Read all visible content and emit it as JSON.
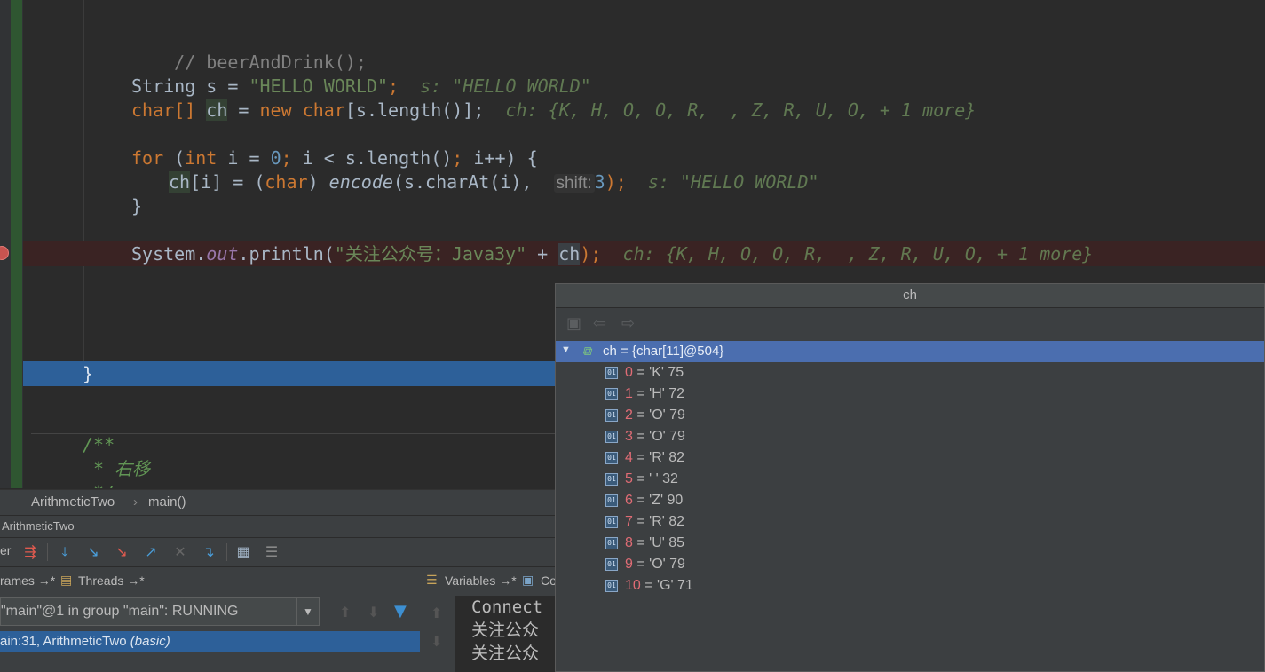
{
  "editor": {
    "comment_line": "// beerAndDrink();",
    "line_s": {
      "type": "String",
      "var": "s",
      "op": " = ",
      "value": "\"HELLO WORLD\"",
      "semi": ";",
      "inline": "s: \"HELLO WORLD\""
    },
    "line_ch": {
      "type": "char[]",
      "var": "ch",
      "op": " = ",
      "new_kw": "new",
      "type2": "char",
      "rest": "[s.length()];",
      "inline": "ch: {K, H, O, O, R,  , Z, R, U, O, + 1 more}"
    },
    "for_line": {
      "kw": "for",
      "open": " (",
      "int_kw": "int",
      "mid": " i = ",
      "zero": "0",
      "semi1": ";",
      "cond": " i < s.length()",
      "semi2": ";",
      "end": " i++) {"
    },
    "body_line": {
      "target": "ch",
      "idx": "[i] = (",
      "cast": "char",
      "close": ") ",
      "method": "encode",
      "args": "(s.charAt(i), ",
      "hint_name": "shift:",
      "hint_val": "3",
      "end": ");",
      "inline": "s: \"HELLO WORLD\""
    },
    "brace_close": "}",
    "print_line": {
      "sys": "System.",
      "out": "out",
      "println": ".println(",
      "str": "\"关注公众号：Java3y\"",
      "plus": " + ",
      "ch": "ch",
      "end": ");",
      "inline": "ch: {K, H, O, O, R,  , Z, R, U, O, + 1 more}"
    },
    "exec_brace": "}",
    "doc1": "/**",
    "doc2": " * 右移",
    "doc3": " */"
  },
  "breadcrumb": {
    "class": "ArithmeticTwo",
    "sep": "›",
    "method": "main()"
  },
  "debug": {
    "title": "ArithmeticTwo",
    "tab_debugger": "er",
    "tabs": {
      "frames": "rames →*",
      "threads": "Threads →*",
      "variables": "Variables →*",
      "console": "Co"
    },
    "thread_select": "\"main\"@1 in group \"main\": RUNNING",
    "frame_row": {
      "text": "ain:31, ArithmeticTwo ",
      "extra": "(basic)"
    },
    "console_lines": [
      "Connect",
      "关注公众",
      "关注公众"
    ]
  },
  "popup": {
    "title": "ch",
    "root": "ch = {char[11]@504}",
    "items": [
      {
        "i": "0",
        "v": " = 'K' 75"
      },
      {
        "i": "1",
        "v": " = 'H' 72"
      },
      {
        "i": "2",
        "v": " = 'O' 79"
      },
      {
        "i": "3",
        "v": " = 'O' 79"
      },
      {
        "i": "4",
        "v": " = 'R' 82"
      },
      {
        "i": "5",
        "v": " = ' ' 32"
      },
      {
        "i": "6",
        "v": " = 'Z' 90"
      },
      {
        "i": "7",
        "v": " = 'R' 82"
      },
      {
        "i": "8",
        "v": " = 'U' 85"
      },
      {
        "i": "9",
        "v": " = 'O' 79"
      },
      {
        "i": "10",
        "v": " = 'G' 71"
      }
    ]
  },
  "icons": {
    "breakpoint": "breakpoint-icon",
    "collapse": "triangle-down-icon",
    "field": "field-icon"
  }
}
